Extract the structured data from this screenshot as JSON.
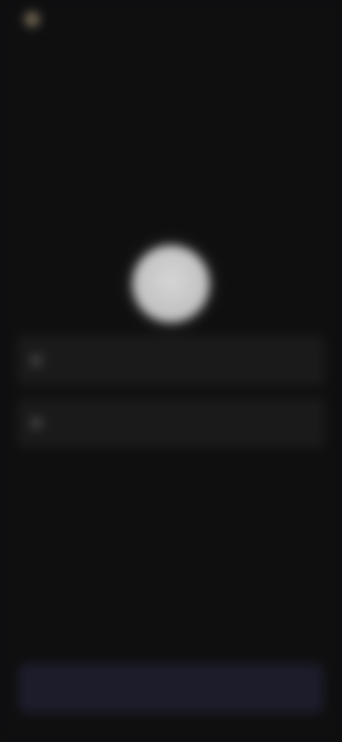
{
  "header": {
    "brand_label": "",
    "top_action": "",
    "top_sub": ""
  },
  "form": {
    "field1_placeholder": "",
    "field2_placeholder": "",
    "helper_text": ""
  },
  "footer": {
    "primary_button_label": ""
  },
  "colors": {
    "background": "#0f0f10",
    "field_bg": "#1a1a1b",
    "button_bg": "#1c1c2b",
    "avatar": "#c8c8c8"
  },
  "icons": {
    "brand": "app-logo-icon",
    "avatar": "avatar-placeholder",
    "field1": "field-icon",
    "field2": "field-icon"
  }
}
